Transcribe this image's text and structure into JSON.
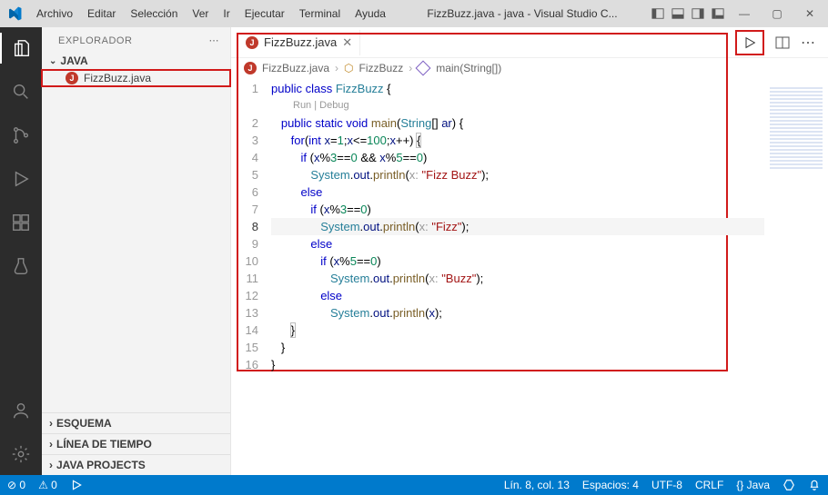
{
  "titlebar": {
    "menus": [
      "Archivo",
      "Editar",
      "Selección",
      "Ver",
      "Ir",
      "Ejecutar",
      "Terminal",
      "Ayuda"
    ],
    "title": "FizzBuzz.java - java - Visual Studio C..."
  },
  "sidebar": {
    "header": "EXPLORADOR",
    "project": "JAVA",
    "file": "FizzBuzz.java",
    "sections": {
      "esquema": "ESQUEMA",
      "timeline": "LÍNEA DE TIEMPO",
      "javaprojects": "JAVA PROJECTS"
    }
  },
  "tab": {
    "label": "FizzBuzz.java"
  },
  "breadcrumbs": {
    "file": "FizzBuzz.java",
    "class": "FizzBuzz",
    "method": "main(String[])"
  },
  "codelens": {
    "run": "Run",
    "debug": "Debug"
  },
  "statusbar": {
    "errors": "0",
    "warnings": "0",
    "linecol": "Lín. 8, col. 13",
    "spaces": "Espacios: 4",
    "encoding": "UTF-8",
    "eol": "CRLF",
    "lang": "{} Java"
  },
  "code": {
    "current_line": 8,
    "lines": [
      [
        {
          "t": "public ",
          "c": "kw"
        },
        {
          "t": "class ",
          "c": "kw"
        },
        {
          "t": "FizzBuzz",
          "c": "cls"
        },
        {
          "t": " {",
          "c": "op"
        }
      ],
      "__codelens__",
      [
        {
          "t": "   ",
          "c": ""
        },
        {
          "t": "public ",
          "c": "kw"
        },
        {
          "t": "static ",
          "c": "kw"
        },
        {
          "t": "void ",
          "c": "type"
        },
        {
          "t": "main",
          "c": "fn"
        },
        {
          "t": "(",
          "c": "op"
        },
        {
          "t": "String",
          "c": "cls"
        },
        {
          "t": "[] ",
          "c": "op"
        },
        {
          "t": "ar",
          "c": "var"
        },
        {
          "t": ") {",
          "c": "op"
        }
      ],
      [
        {
          "t": "      ",
          "c": ""
        },
        {
          "t": "for",
          "c": "kw"
        },
        {
          "t": "(",
          "c": "op"
        },
        {
          "t": "int ",
          "c": "type"
        },
        {
          "t": "x",
          "c": "var"
        },
        {
          "t": "=",
          "c": "op"
        },
        {
          "t": "1",
          "c": "num"
        },
        {
          "t": ";",
          "c": "op"
        },
        {
          "t": "x",
          "c": "var"
        },
        {
          "t": "<=",
          "c": "op"
        },
        {
          "t": "100",
          "c": "num"
        },
        {
          "t": ";",
          "c": "op"
        },
        {
          "t": "x",
          "c": "var"
        },
        {
          "t": "++) ",
          "c": "op"
        },
        {
          "t": "{",
          "c": "op hb"
        }
      ],
      [
        {
          "t": "         ",
          "c": ""
        },
        {
          "t": "if ",
          "c": "kw"
        },
        {
          "t": "(",
          "c": "op"
        },
        {
          "t": "x",
          "c": "var"
        },
        {
          "t": "%",
          "c": "op"
        },
        {
          "t": "3",
          "c": "num"
        },
        {
          "t": "==",
          "c": "op"
        },
        {
          "t": "0",
          "c": "num"
        },
        {
          "t": " && ",
          "c": "op"
        },
        {
          "t": "x",
          "c": "var"
        },
        {
          "t": "%",
          "c": "op"
        },
        {
          "t": "5",
          "c": "num"
        },
        {
          "t": "==",
          "c": "op"
        },
        {
          "t": "0",
          "c": "num"
        },
        {
          "t": ")",
          "c": "op"
        }
      ],
      [
        {
          "t": "            ",
          "c": ""
        },
        {
          "t": "System",
          "c": "cls"
        },
        {
          "t": ".",
          "c": "op"
        },
        {
          "t": "out",
          "c": "var"
        },
        {
          "t": ".",
          "c": "op"
        },
        {
          "t": "println",
          "c": "fn"
        },
        {
          "t": "(",
          "c": "op"
        },
        {
          "t": "x: ",
          "c": "hint"
        },
        {
          "t": "\"Fizz Buzz\"",
          "c": "str"
        },
        {
          "t": ");",
          "c": "op"
        }
      ],
      [
        {
          "t": "         ",
          "c": ""
        },
        {
          "t": "else",
          "c": "kw"
        }
      ],
      [
        {
          "t": "            ",
          "c": ""
        },
        {
          "t": "if ",
          "c": "kw"
        },
        {
          "t": "(",
          "c": "op"
        },
        {
          "t": "x",
          "c": "var"
        },
        {
          "t": "%",
          "c": "op"
        },
        {
          "t": "3",
          "c": "num"
        },
        {
          "t": "==",
          "c": "op"
        },
        {
          "t": "0",
          "c": "num"
        },
        {
          "t": ")",
          "c": "op"
        }
      ],
      [
        {
          "t": "               ",
          "c": ""
        },
        {
          "t": "System",
          "c": "cls"
        },
        {
          "t": ".",
          "c": "op"
        },
        {
          "t": "out",
          "c": "var"
        },
        {
          "t": ".",
          "c": "op"
        },
        {
          "t": "println",
          "c": "fn"
        },
        {
          "t": "(",
          "c": "op"
        },
        {
          "t": "x: ",
          "c": "hint"
        },
        {
          "t": "\"Fizz\"",
          "c": "str"
        },
        {
          "t": ");",
          "c": "op"
        }
      ],
      [
        {
          "t": "            ",
          "c": ""
        },
        {
          "t": "else",
          "c": "kw"
        }
      ],
      [
        {
          "t": "               ",
          "c": ""
        },
        {
          "t": "if ",
          "c": "kw"
        },
        {
          "t": "(",
          "c": "op"
        },
        {
          "t": "x",
          "c": "var"
        },
        {
          "t": "%",
          "c": "op"
        },
        {
          "t": "5",
          "c": "num"
        },
        {
          "t": "==",
          "c": "op"
        },
        {
          "t": "0",
          "c": "num"
        },
        {
          "t": ")",
          "c": "op"
        }
      ],
      [
        {
          "t": "                  ",
          "c": ""
        },
        {
          "t": "System",
          "c": "cls"
        },
        {
          "t": ".",
          "c": "op"
        },
        {
          "t": "out",
          "c": "var"
        },
        {
          "t": ".",
          "c": "op"
        },
        {
          "t": "println",
          "c": "fn"
        },
        {
          "t": "(",
          "c": "op"
        },
        {
          "t": "x: ",
          "c": "hint"
        },
        {
          "t": "\"Buzz\"",
          "c": "str"
        },
        {
          "t": ");",
          "c": "op"
        }
      ],
      [
        {
          "t": "               ",
          "c": ""
        },
        {
          "t": "else",
          "c": "kw"
        }
      ],
      [
        {
          "t": "                  ",
          "c": ""
        },
        {
          "t": "System",
          "c": "cls"
        },
        {
          "t": ".",
          "c": "op"
        },
        {
          "t": "out",
          "c": "var"
        },
        {
          "t": ".",
          "c": "op"
        },
        {
          "t": "println",
          "c": "fn"
        },
        {
          "t": "(",
          "c": "op"
        },
        {
          "t": "x",
          "c": "var"
        },
        {
          "t": ");",
          "c": "op"
        }
      ],
      [
        {
          "t": "      ",
          "c": ""
        },
        {
          "t": "}",
          "c": "op hb"
        }
      ],
      [
        {
          "t": "   }",
          "c": "op"
        }
      ],
      [
        {
          "t": "}",
          "c": "op"
        }
      ]
    ]
  }
}
